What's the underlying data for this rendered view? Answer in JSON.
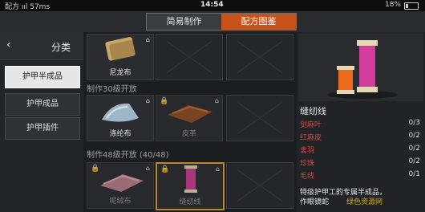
{
  "status": {
    "left": "配方 ııl 57ms",
    "time": "14:54",
    "battery": "18%"
  },
  "tabs": [
    {
      "label": "简易制作"
    },
    {
      "label": "配方图鉴"
    }
  ],
  "sidebar": {
    "back": "‹",
    "title": "分类",
    "items": [
      {
        "label": "护甲半成品"
      },
      {
        "label": "护甲成品"
      },
      {
        "label": "护甲插件"
      }
    ]
  },
  "sections": [
    {
      "label": "制作30级开放"
    },
    {
      "label": "制作48级开放 (40/48)"
    }
  ],
  "slots": [
    {
      "name": "尼龙布",
      "locked": false
    },
    {
      "name": "",
      "locked": false
    },
    {
      "name": "",
      "locked": false
    },
    {
      "name": "涤纶布",
      "locked": false
    },
    {
      "name": "皮革",
      "locked": true
    },
    {
      "name": "",
      "locked": false
    },
    {
      "name": "呢绒布",
      "locked": true
    },
    {
      "name": "缝纫线",
      "locked": true
    },
    {
      "name": "",
      "locked": false
    }
  ],
  "detail": {
    "name": "缝纫线",
    "materials": [
      {
        "name": "剑麻叶",
        "count": "0/3"
      },
      {
        "name": "红麻皮",
        "count": "0/2"
      },
      {
        "name": "禽羽",
        "count": "0/2"
      },
      {
        "name": "珍珠",
        "count": "0/2"
      },
      {
        "name": "毛线",
        "count": "0/1"
      }
    ],
    "description": "特级护甲工的专属半成品，",
    "description2": "作眼镜蛇",
    "watermark": "绿色资源网"
  },
  "colors": {
    "accent": "#c6531b",
    "selected": "#d19a2e",
    "material": "#c94a3f"
  }
}
